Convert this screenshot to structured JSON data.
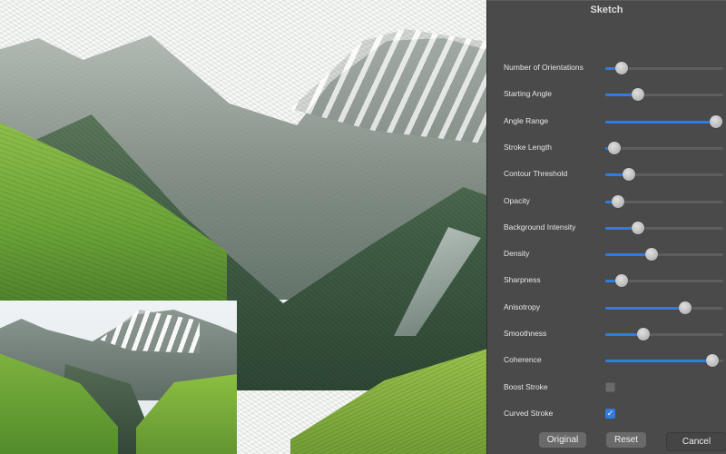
{
  "panel": {
    "title": "Sketch",
    "controls": [
      {
        "label": "Number of Orientations",
        "type": "slider",
        "value": 0.14
      },
      {
        "label": "Starting Angle",
        "type": "slider",
        "value": 0.28
      },
      {
        "label": "Angle Range",
        "type": "slider",
        "value": 0.94
      },
      {
        "label": "Stroke Length",
        "type": "slider",
        "value": 0.08
      },
      {
        "label": "Contour Threshold",
        "type": "slider",
        "value": 0.2
      },
      {
        "label": "Opacity",
        "type": "slider",
        "value": 0.11
      },
      {
        "label": "Background Intensity",
        "type": "slider",
        "value": 0.28
      },
      {
        "label": "Density",
        "type": "slider",
        "value": 0.39
      },
      {
        "label": "Sharpness",
        "type": "slider",
        "value": 0.14
      },
      {
        "label": "Anisotropy",
        "type": "slider",
        "value": 0.68
      },
      {
        "label": "Smoothness",
        "type": "slider",
        "value": 0.32
      },
      {
        "label": "Coherence",
        "type": "slider",
        "value": 0.91
      },
      {
        "label": "Boost Stroke",
        "type": "checkbox",
        "checked": false
      },
      {
        "label": "Curved Stroke",
        "type": "checkbox",
        "checked": true
      }
    ],
    "buttons": {
      "original": "Original",
      "reset": "Reset",
      "cancel": "Cancel"
    }
  },
  "colors": {
    "accent": "#2f7de0",
    "panel_bg": "#4a4a4a"
  }
}
